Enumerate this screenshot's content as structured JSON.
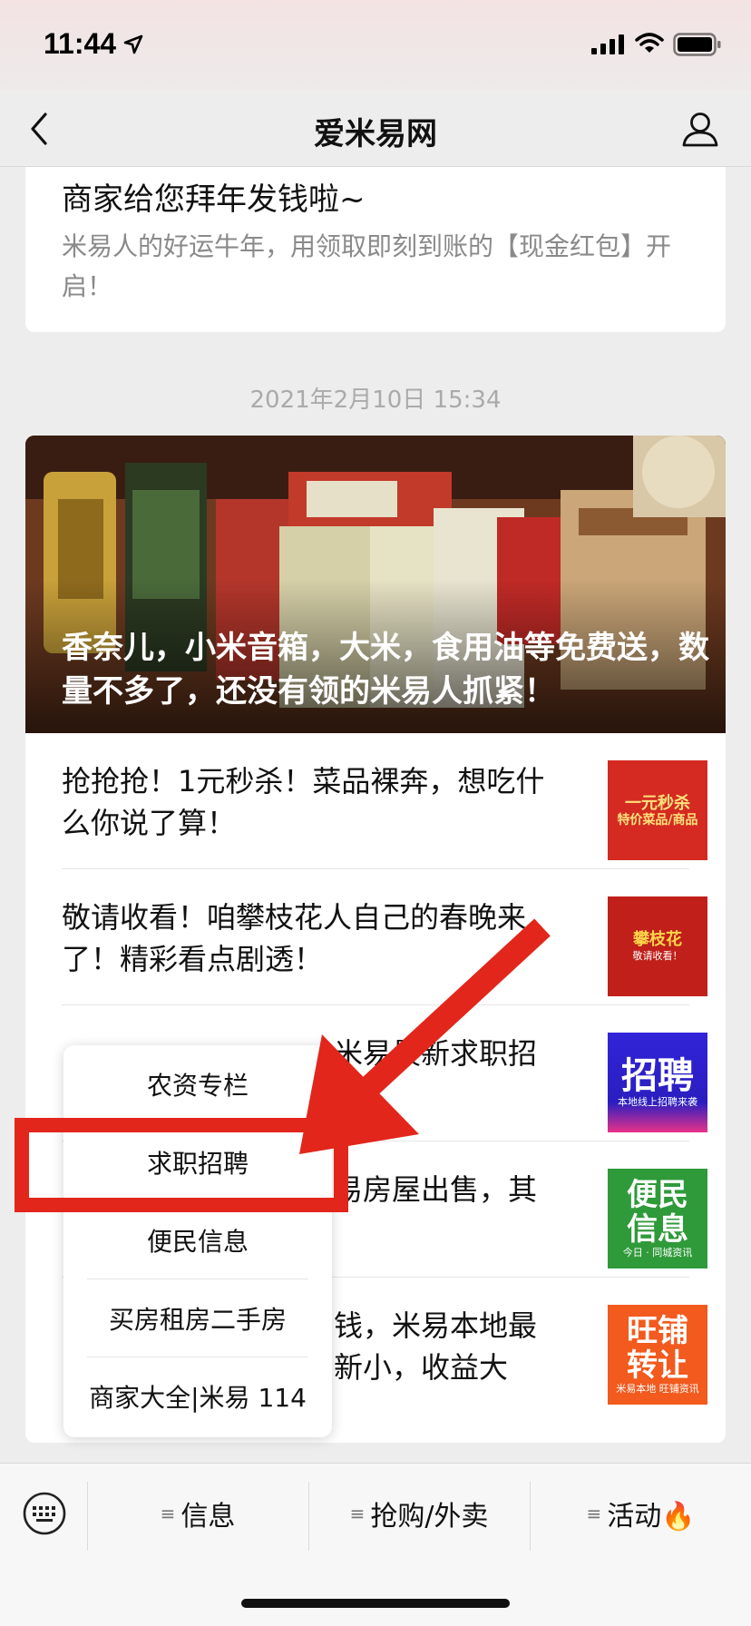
{
  "status_bar": {
    "time": "11:44"
  },
  "nav": {
    "title": "爱米易网"
  },
  "top_article": {
    "title": "商家给您拜年发钱啦~",
    "desc": "米易人的好运牛年，用领取即刻到账的【现金红包】开启！"
  },
  "timestamp": "2021年2月10日 15:34",
  "hero": {
    "caption": "香奈儿，小米音箱，大米，食用油等免费送，数量不多了，还没有领的米易人抓紧！"
  },
  "articles": [
    {
      "text": "抢抢抢！1元秒杀！菜品裸奔，想吃什么你说了算！",
      "thumb_big": "一元秒杀",
      "thumb_small": "特价菜品/商品"
    },
    {
      "text": "敬请收看！咱攀枝花人自己的春晚来了！精彩看点剧透！",
      "thumb_big": "攀枝花",
      "thumb_small": "敬请收看！"
    },
    {
      "text": "米易最新求职招聘",
      "thumb_big": "招聘",
      "thumb_small": "本地线上招聘来袭"
    },
    {
      "text": "易房屋出售，其",
      "thumb_big": "便民信息",
      "thumb_small": "今日 · 同城资讯"
    },
    {
      "text": "钱，米易本地最新小，收益大",
      "thumb_big": "旺铺转让",
      "thumb_small": "米易本地 旺铺资讯"
    }
  ],
  "popup_menu": {
    "items": [
      "农资专栏",
      "求职招聘",
      "便民信息",
      "买房租房二手房",
      "商家大全|米易 114"
    ]
  },
  "tabbar": {
    "tabs": [
      {
        "label": "信息"
      },
      {
        "label": "抢购/外卖"
      },
      {
        "label": "活动🔥"
      }
    ]
  },
  "colors": {
    "highlight_red": "#e2261b",
    "background": "#ededed"
  }
}
